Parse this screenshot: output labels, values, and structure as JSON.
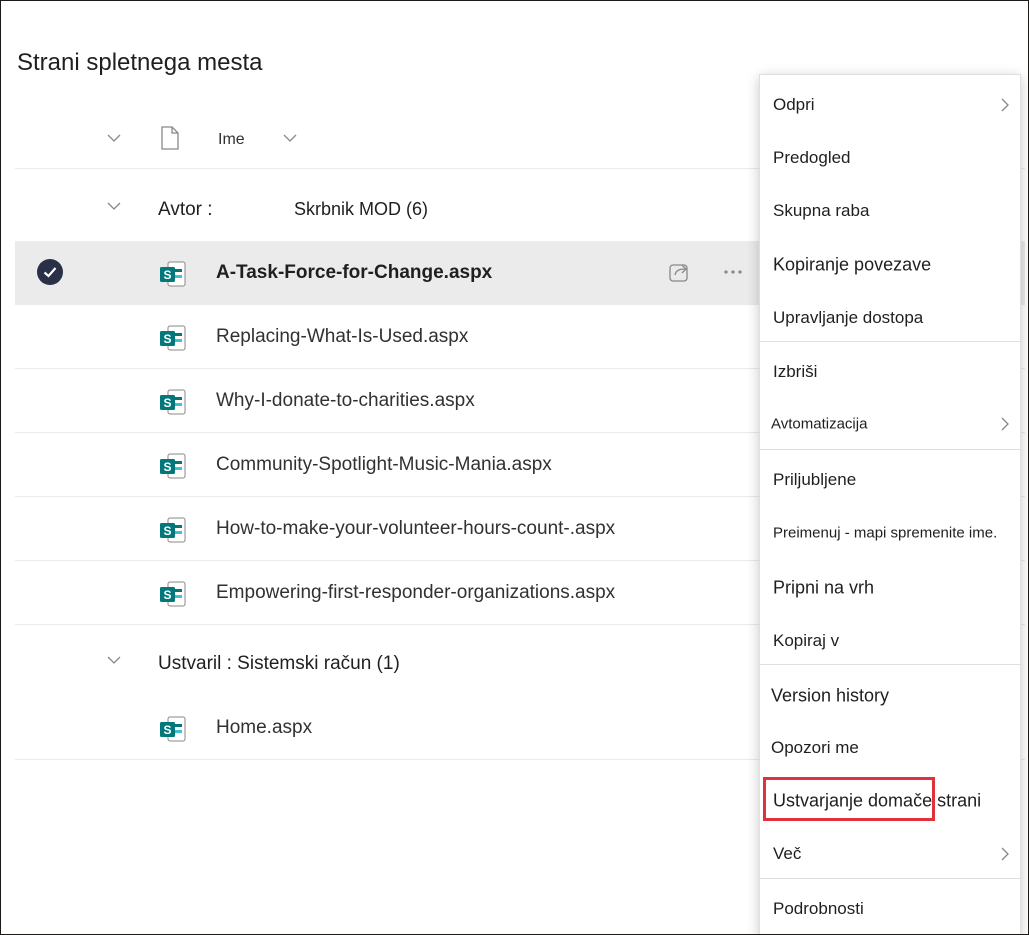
{
  "page": {
    "title": "Strani spletnega mesta"
  },
  "header": {
    "name_column": "Ime"
  },
  "groups": [
    {
      "label": "Avtor :",
      "value": "Skrbnik MOD (6)"
    },
    {
      "label": "Ustvaril : Sistemski račun (1)"
    }
  ],
  "files_group1": [
    {
      "name": "A-Task-Force-for-Change.aspx",
      "selected": true
    },
    {
      "name": "Replacing-What-Is-Used.aspx"
    },
    {
      "name": "Why-I-donate-to-charities.aspx"
    },
    {
      "name": "Community-Spotlight-Music-Mania.aspx"
    },
    {
      "name": "How-to-make-your-volunteer-hours-count-.aspx"
    },
    {
      "name": "Empowering-first-responder-organizations.aspx"
    }
  ],
  "files_group2": [
    {
      "name": "Home.aspx"
    }
  ],
  "menu": {
    "items": [
      {
        "label": "Odpri",
        "submenu": true
      },
      {
        "label": "Predogled"
      },
      {
        "label": "Skupna raba"
      },
      {
        "label": "Kopiranje povezave"
      },
      {
        "label": "Upravljanje dostopa"
      },
      {
        "label": "Izbriši"
      },
      {
        "label": "Avtomatizacija",
        "submenu": true
      },
      {
        "label": "Priljubljene"
      },
      {
        "label": "Preimenuj - mapi spremenite ime."
      },
      {
        "label": "Pripni na vrh"
      },
      {
        "label": "Kopiraj v"
      },
      {
        "label": "Version history"
      },
      {
        "label": "Opozori me"
      },
      {
        "label": "Ustvarjanje domače strani",
        "highlighted": true
      },
      {
        "label": "Več",
        "submenu": true
      },
      {
        "label": "Podrobnosti"
      }
    ]
  },
  "colors": {
    "selected_row": "#ebebeb",
    "check_circle": "#2a3048",
    "sharepoint_teal": "#03787c",
    "highlight_border": "#e0323c"
  }
}
